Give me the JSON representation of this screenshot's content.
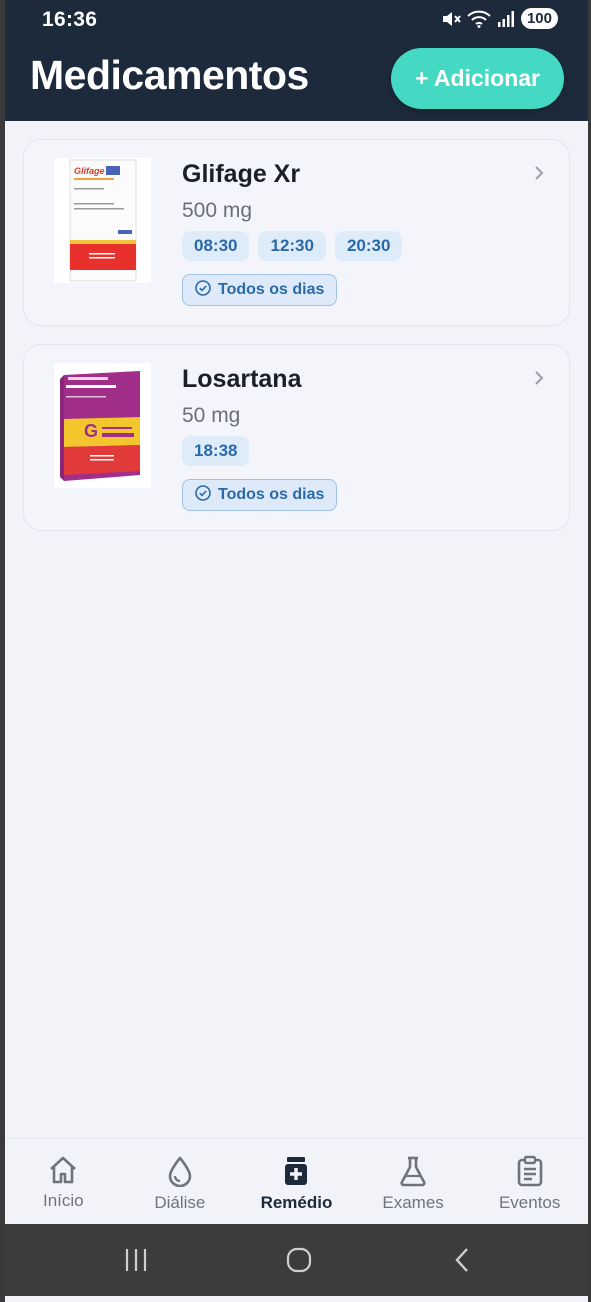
{
  "status_bar": {
    "time": "16:36",
    "battery": "100"
  },
  "header": {
    "title": "Medicamentos",
    "add_button_label": "+ Adicionar"
  },
  "medications": [
    {
      "name": "Glifage Xr",
      "dose": "500 mg",
      "times": [
        "08:30",
        "12:30",
        "20:30"
      ],
      "frequency": "Todos os dias",
      "image_label": "Glifage XR"
    },
    {
      "name": "Losartana",
      "dose": "50 mg",
      "times": [
        "18:38"
      ],
      "frequency": "Todos os dias",
      "image_label": "losartana potássica"
    }
  ],
  "bottom_nav": {
    "items": [
      {
        "label": "Início",
        "icon": "home-icon",
        "active": false
      },
      {
        "label": "Diálise",
        "icon": "droplet-icon",
        "active": false
      },
      {
        "label": "Remédio",
        "icon": "medicine-icon",
        "active": true
      },
      {
        "label": "Exames",
        "icon": "flask-icon",
        "active": false
      },
      {
        "label": "Eventos",
        "icon": "clipboard-icon",
        "active": false
      }
    ]
  },
  "colors": {
    "header_bg": "#1c2a3b",
    "accent": "#45d9c3",
    "pill_bg": "#deecfa",
    "pill_text": "#2a6aa8"
  }
}
